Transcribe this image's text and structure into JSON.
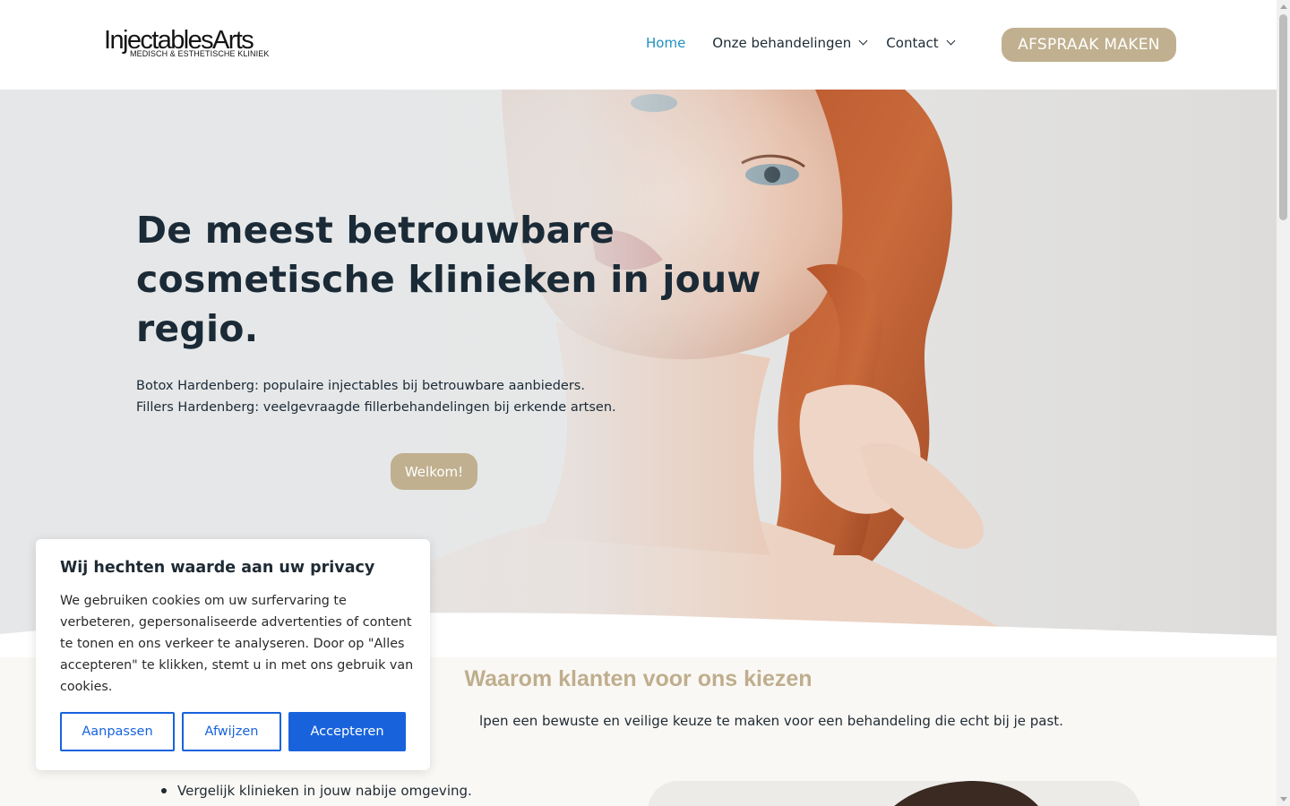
{
  "header": {
    "logo": {
      "main": "InjectablesArts",
      "sub": "MEDISCH & ESTHETISCHE KLINIEK"
    },
    "nav": {
      "home": "Home",
      "treatments": "Onze behandelingen",
      "contact": "Contact"
    },
    "cta": "AFSPRAAK MAKEN"
  },
  "hero": {
    "title": "De meest betrouwbare cosmetische klinieken in jouw regio.",
    "line1": "Botox Hardenberg: populaire injectables bij betrouwbare aanbieders.",
    "line2": "Fillers Hardenberg: veelgevraagde fillerbehandelingen bij erkende artsen.",
    "button": "Welkom!"
  },
  "section": {
    "title": "Waarom klanten voor ons kiezen",
    "intro_visible": "lpen een bewuste en veilige keuze te maken voor een behandeling die echt bij je past.",
    "list": [
      "Vergelijk klinieken in jouw nabije omgeving."
    ]
  },
  "cookie": {
    "title": "Wij hechten waarde aan uw privacy",
    "text": "We gebruiken cookies om uw surfervaring te verbeteren, gepersonaliseerde advertenties of content te tonen en ons verkeer te analyseren. Door op \"Alles accepteren\" te klikken, stemt u in met ons gebruik van cookies.",
    "customize": "Aanpassen",
    "reject": "Afwijzen",
    "accept": "Accepteren"
  },
  "colors": {
    "accent": "#c0b08f",
    "nav_active": "#1f8fbf",
    "cookie_blue": "#1863dc",
    "text_dark": "#1a2a36"
  }
}
